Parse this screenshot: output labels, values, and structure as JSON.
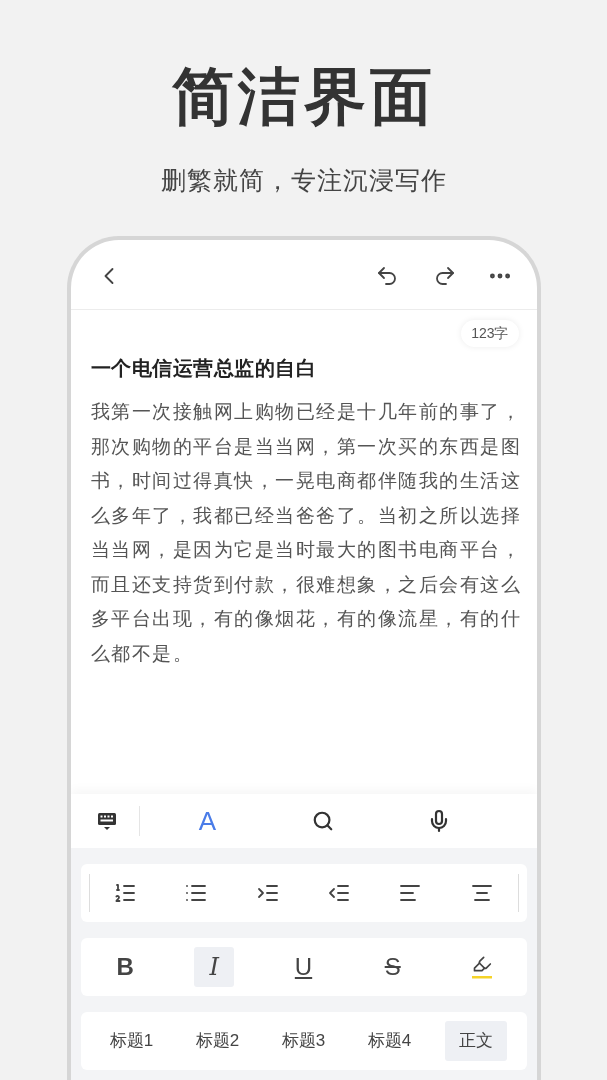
{
  "headline": "简洁界面",
  "subheadline": "删繁就简，专注沉浸写作",
  "editor": {
    "word_count": "123字",
    "title": "一个电信运营总监的自白",
    "body": "我第一次接触网上购物已经是十几年前的事了，那次购物的平台是当当网，第一次买的东西是图书，时间过得真快，一晃电商都伴随我的生活这么多年了，我都已经当爸爸了。当初之所以选择当当网，是因为它是当时最大的图书电商平台，而且还支持货到付款，很难想象，之后会有这么多平台出现，有的像烟花，有的像流星，有的什么都不是。"
  },
  "toolbar": [
    {
      "kind": "keyboard",
      "selected": false
    },
    {
      "kind": "text",
      "label": "A",
      "selected": true
    },
    {
      "kind": "search",
      "selected": false
    },
    {
      "kind": "mic",
      "selected": false
    }
  ],
  "format_tools": [
    {
      "kind": "text",
      "label": "B",
      "selected": false
    },
    {
      "kind": "text",
      "label": "I",
      "selected": true
    },
    {
      "kind": "text",
      "label": "U",
      "selected": false
    },
    {
      "kind": "text",
      "label": "S",
      "selected": false
    },
    {
      "kind": "highlight",
      "selected": false
    }
  ],
  "styles": [
    {
      "label": "标题1",
      "selected": false
    },
    {
      "label": "标题2",
      "selected": false
    },
    {
      "label": "标题3",
      "selected": false
    },
    {
      "label": "标题4",
      "selected": false
    },
    {
      "label": "正文",
      "selected": true
    }
  ]
}
